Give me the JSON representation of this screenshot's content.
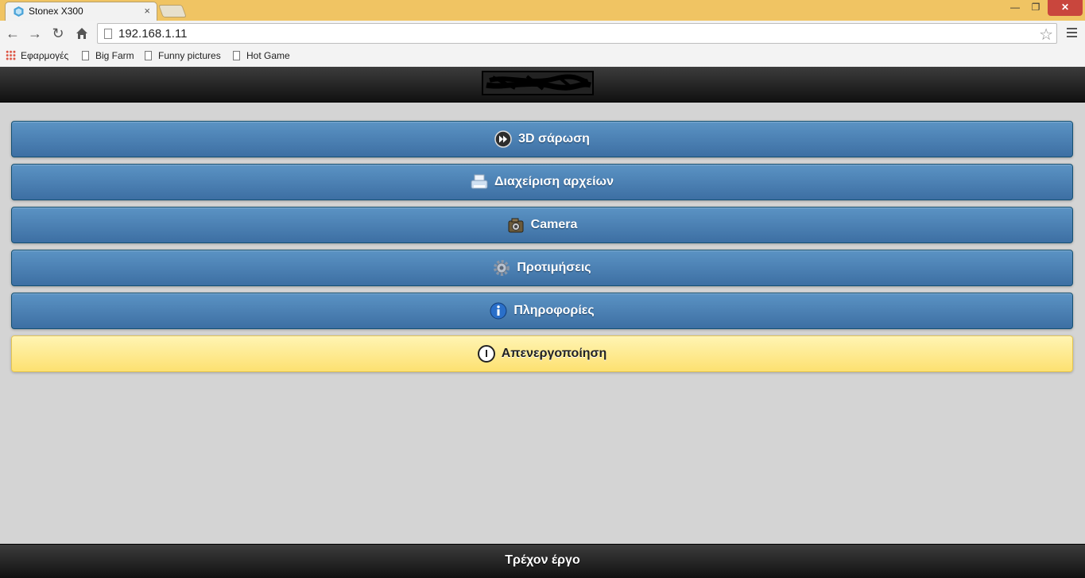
{
  "browser": {
    "tab_title": "Stonex X300",
    "tab_close": "×",
    "window_min": "—",
    "window_max": "❐",
    "window_close": "✕",
    "url": "192.168.1.11",
    "bookmarks": [
      {
        "label": "Εφαρμογές"
      },
      {
        "label": "Big Farm"
      },
      {
        "label": "Funny pictures"
      },
      {
        "label": "Hot Game"
      }
    ]
  },
  "menu": {
    "items": [
      {
        "label": "3D σάρωση",
        "icon": "fast-forward-icon"
      },
      {
        "label": "Διαχείριση αρχείων",
        "icon": "printer-icon"
      },
      {
        "label": "Camera",
        "icon": "camera-icon"
      },
      {
        "label": "Προτιμήσεις",
        "icon": "gear-icon"
      },
      {
        "label": "Πληροφορίες",
        "icon": "info-icon"
      },
      {
        "label": "Απενεργοποίηση",
        "icon": "power-icon"
      }
    ]
  },
  "footer": {
    "label": "Τρέχον έργο"
  },
  "colors": {
    "titlebar": "#f0c463",
    "button_blue": "#4a80b5",
    "button_yellow": "#fde171",
    "header_bg": "#1a1a1a",
    "content_bg": "#d4d4d4"
  }
}
